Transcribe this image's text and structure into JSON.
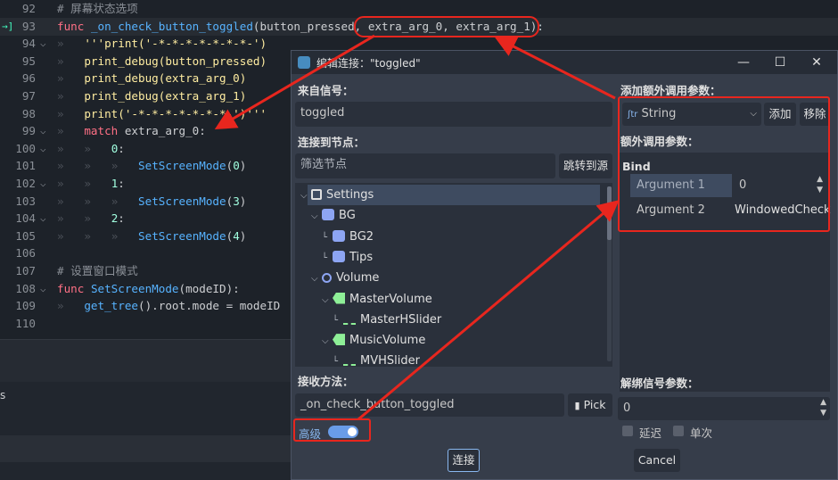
{
  "editor": {
    "lines": [
      {
        "num": "92",
        "html": "<span class='cm'># 屏幕状态选项</span>"
      },
      {
        "num": "93",
        "html": "<span class='kw'>func</span> <span class='fn'>_on_check_button_toggled</span>(button_pressed, extra_arg_0, extra_arg_1):"
      },
      {
        "num": "94",
        "html": "<span class='ind'>»</span>   <span class='str'>'''print('-*-*-*-*-*-*-*-')</span>"
      },
      {
        "num": "95",
        "html": "<span class='ind'>»</span>   <span class='str'>print_debug(button_pressed)</span>"
      },
      {
        "num": "96",
        "html": "<span class='ind'>»</span>   <span class='str'>print_debug(extra_arg_0)</span>"
      },
      {
        "num": "97",
        "html": "<span class='ind'>»</span>   <span class='str'>print_debug(extra_arg_1)</span>"
      },
      {
        "num": "98",
        "html": "<span class='ind'>»</span>   <span class='str'>print('-*-*-*-*-*-*-*-')'''</span>"
      },
      {
        "num": "99",
        "html": "<span class='ind'>»</span>   <span class='kw'>match</span> extra_arg_0:"
      },
      {
        "num": "100",
        "html": "<span class='ind'>»</span>   <span class='ind'>»</span>   <span class='num'>0</span>:"
      },
      {
        "num": "101",
        "html": "<span class='ind'>»</span>   <span class='ind'>»</span>   <span class='ind'>»</span>   <span class='fn'>SetScreenMode</span>(<span class='num'>0</span>)"
      },
      {
        "num": "102",
        "html": "<span class='ind'>»</span>   <span class='ind'>»</span>   <span class='num'>1</span>:"
      },
      {
        "num": "103",
        "html": "<span class='ind'>»</span>   <span class='ind'>»</span>   <span class='ind'>»</span>   <span class='fn'>SetScreenMode</span>(<span class='num'>3</span>)"
      },
      {
        "num": "104",
        "html": "<span class='ind'>»</span>   <span class='ind'>»</span>   <span class='num'>2</span>:"
      },
      {
        "num": "105",
        "html": "<span class='ind'>»</span>   <span class='ind'>»</span>   <span class='ind'>»</span>   <span class='fn'>SetScreenMode</span>(<span class='num'>4</span>)"
      },
      {
        "num": "106",
        "html": ""
      },
      {
        "num": "107",
        "html": "<span class='cm'># 设置窗口模式</span>"
      },
      {
        "num": "108",
        "html": "<span class='kw'>func</span> <span class='fn'>SetScreenMode</span>(modeID):"
      },
      {
        "num": "109",
        "html": "<span class='ind'>»</span>   <span class='fn'>get_tree</span>().root.mode = modeID"
      },
      {
        "num": "110",
        "html": ""
      }
    ],
    "lower_text": "s"
  },
  "dialog": {
    "title": "编辑连接：\"toggled\"",
    "from_signal_label": "来自信号：",
    "signal_value": "toggled",
    "connect_to_node_label": "连接到节点：",
    "filter_placeholder": "筛选节点",
    "goto_source_button": "跳转到源",
    "tree": [
      {
        "label": "Settings",
        "icon": "settings-node-icon",
        "selected": true
      },
      {
        "label": "BG",
        "icon": "control-node-icon"
      },
      {
        "label": "BG2",
        "icon": "control-node-icon"
      },
      {
        "label": "Tips",
        "icon": "control-node-icon"
      },
      {
        "label": "Volume",
        "icon": "circle-node-icon"
      },
      {
        "label": "MasterVolume",
        "icon": "label-node-icon"
      },
      {
        "label": "MasterHSlider",
        "icon": "hslider-node-icon"
      },
      {
        "label": "MusicVolume",
        "icon": "label-node-icon"
      },
      {
        "label": "MVHSlider",
        "icon": "hslider-node-icon"
      }
    ],
    "receiver_method_label": "接收方法：",
    "receiver_method_value": "_on_check_button_toggled",
    "pick_button": "Pick",
    "advanced_label": "高级",
    "advanced_on": true,
    "add_extra_args_label": "添加额外调用参数：",
    "type_select": "String",
    "add_button": "添加",
    "remove_button": "移除",
    "extra_args_label": "额外调用参数：",
    "bind_label": "Bind",
    "arguments": [
      {
        "name": "Argument 1",
        "value": "0"
      },
      {
        "name": "Argument 2",
        "value": "WindowedCheck"
      }
    ],
    "unbind_label": "解绑信号参数：",
    "unbind_value": "0",
    "deferred_label": "延迟",
    "oneshot_label": "单次",
    "connect_button": "连接",
    "cancel_button": "Cancel"
  },
  "colors": {
    "annotation_red": "#e8261e",
    "toggle_accent": "#699ce8"
  }
}
